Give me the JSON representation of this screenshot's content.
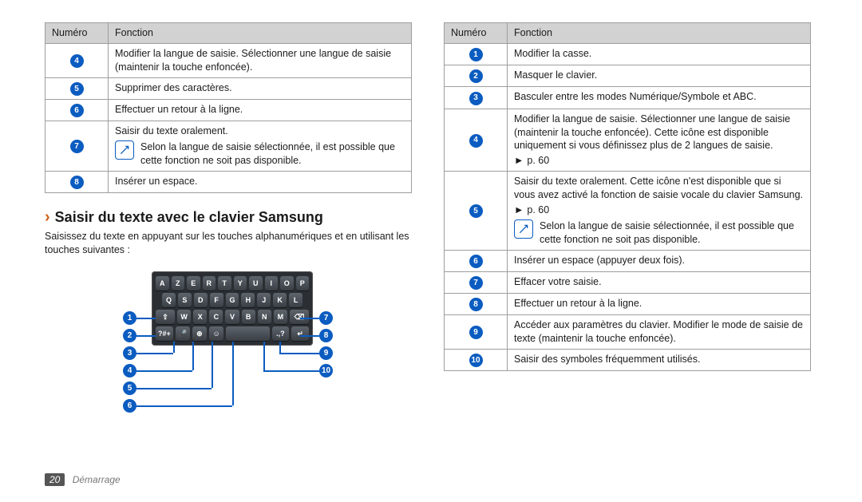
{
  "headers": {
    "num": "Numéro",
    "func": "Fonction"
  },
  "left_table": [
    {
      "n": "4",
      "text": "Modifier la langue de saisie. Sélectionner une langue de saisie (maintenir la touche enfoncée)."
    },
    {
      "n": "5",
      "text": "Supprimer des caractères."
    },
    {
      "n": "6",
      "text": "Effectuer un retour à la ligne."
    },
    {
      "n": "7",
      "text": "Saisir du texte oralement.",
      "note": "Selon la langue de saisie sélectionnée, il est possible que cette fonction ne soit pas disponible."
    },
    {
      "n": "8",
      "text": "Insérer un espace."
    }
  ],
  "section": {
    "title": "Saisir du texte avec le clavier Samsung",
    "intro": "Saisissez du texte en appuyant sur les touches alphanumériques et en utilisant les touches suivantes :"
  },
  "kb": {
    "row1": [
      "A",
      "Z",
      "E",
      "R",
      "T",
      "Y",
      "U",
      "I",
      "O",
      "P"
    ],
    "row2": [
      "Q",
      "S",
      "D",
      "F",
      "G",
      "H",
      "J",
      "K",
      "L"
    ],
    "row3_shift": "⇧",
    "row3": [
      "W",
      "X",
      "C",
      "V",
      "B",
      "N",
      "M"
    ],
    "row3_del": "⌫",
    "row4": {
      "sym": "?#+",
      "voice": "🎤",
      "lang": "⊕",
      "emoji": "☺",
      "space": " ",
      "dot": ".,?",
      "enter": "↵"
    }
  },
  "callouts_left": [
    "1",
    "2",
    "3",
    "4",
    "5",
    "6"
  ],
  "callouts_right": [
    "7",
    "8",
    "9",
    "10"
  ],
  "right_table": [
    {
      "n": "1",
      "text": "Modifier la casse."
    },
    {
      "n": "2",
      "text": "Masquer le clavier."
    },
    {
      "n": "3",
      "text": "Basculer entre les modes Numérique/Symbole et ABC."
    },
    {
      "n": "4",
      "text": "Modifier la langue de saisie. Sélectionner une langue de saisie (maintenir la touche enfoncée). Cette icône est disponible uniquement si vous définissez plus de 2 langues de saisie.",
      "ref": "p. 60"
    },
    {
      "n": "5",
      "text": "Saisir du texte oralement. Cette icône n'est disponible que si vous avez activé la fonction de saisie vocale du clavier Samsung.",
      "ref": "p. 60",
      "note": "Selon la langue de saisie sélectionnée, il est possible que cette fonction ne soit pas disponible."
    },
    {
      "n": "6",
      "text": "Insérer un espace (appuyer deux fois)."
    },
    {
      "n": "7",
      "text": "Effacer votre saisie."
    },
    {
      "n": "8",
      "text": "Effectuer un retour à la ligne."
    },
    {
      "n": "9",
      "text": "Accéder aux paramètres du clavier. Modifier le mode de saisie de texte (maintenir la touche enfoncée)."
    },
    {
      "n": "10",
      "text": "Saisir des symboles fréquemment utilisés."
    }
  ],
  "footer": {
    "page": "20",
    "chapter": "Démarrage"
  }
}
